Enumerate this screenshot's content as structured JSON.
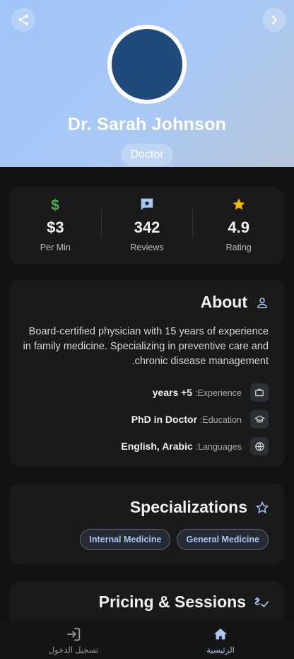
{
  "header": {
    "name": "Dr. Sarah Johnson",
    "role": "Doctor"
  },
  "stats": [
    {
      "value": "$3",
      "label": "Per Min",
      "icon": "dollar-icon"
    },
    {
      "value": "342",
      "label": "Reviews",
      "icon": "review-icon"
    },
    {
      "value": "4.9",
      "label": "Rating",
      "icon": "star-icon"
    }
  ],
  "about": {
    "title": "About",
    "description": "Board-certified physician with 15 years of experience in family medicine. Specializing in preventive care and chronic disease management.",
    "experience": {
      "key": ":Experience",
      "value": "years +5"
    },
    "education": {
      "key": ":Education",
      "value": "PhD in Doctor"
    },
    "languages": {
      "key": ":Languages",
      "value": "English, Arabic"
    }
  },
  "specializations": {
    "title": "Specializations",
    "items": [
      "General Medicine",
      "Internal Medicine"
    ]
  },
  "pricing": {
    "title": "Pricing & Sessions"
  },
  "nav": {
    "home": "الرئيسية",
    "login": "تسجيل الدخول"
  },
  "colors": {
    "accent": "#a8c7f2",
    "dollar": "#4caf50",
    "star": "#f5b800",
    "avatar": "#1e4a7c"
  }
}
